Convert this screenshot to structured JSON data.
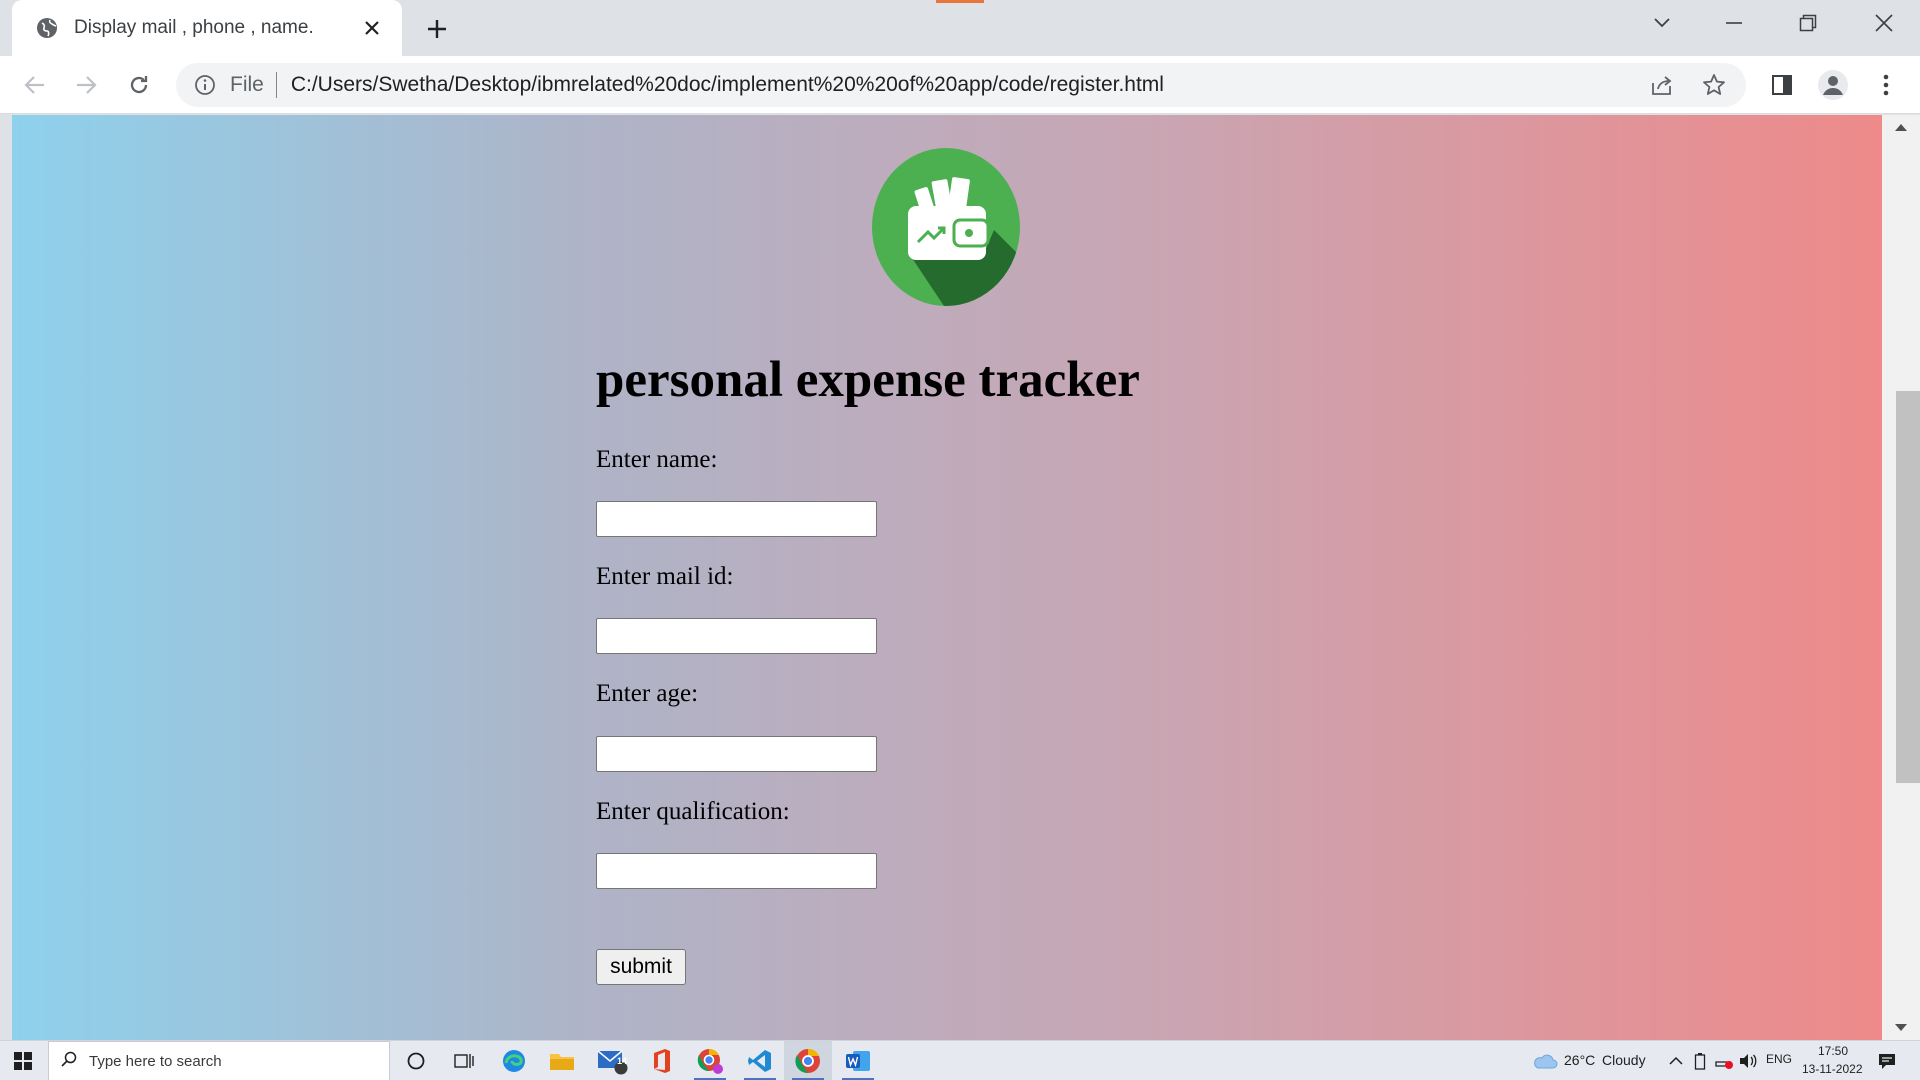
{
  "browser": {
    "tab_title": "Display mail , phone , name.",
    "omnibox": {
      "scheme_label": "File",
      "url": "C:/Users/Swetha/Desktop/ibmrelated%20doc/implement%20%20of%20app/code/register.html"
    }
  },
  "page": {
    "title": "personal expense tracker",
    "logo_icon": "wallet-icon",
    "colors": {
      "gradient_left": "#8ed1ec",
      "gradient_right": "#ee8a8a",
      "logo_green": "#4caf50",
      "logo_shadow": "#256b2e"
    },
    "fields": [
      {
        "label": "Enter name:",
        "value": ""
      },
      {
        "label": "Enter mail id:",
        "value": ""
      },
      {
        "label": "Enter age:",
        "value": ""
      },
      {
        "label": "Enter qualification:",
        "value": ""
      }
    ],
    "submit_label": "submit"
  },
  "taskbar": {
    "search_placeholder": "Type here to search",
    "mail_badge": "14",
    "weather_temp": "26°C",
    "weather_text": "Cloudy",
    "language": "ENG",
    "time": "17:50",
    "date": "13-11-2022"
  }
}
